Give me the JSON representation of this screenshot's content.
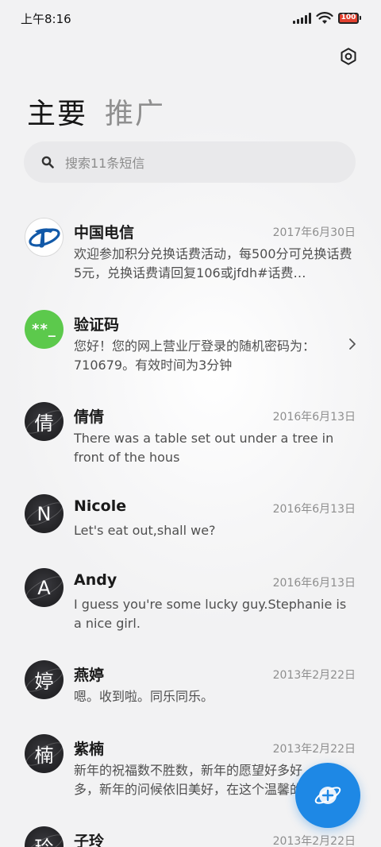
{
  "status_bar": {
    "time": "上午8:16",
    "battery": "100"
  },
  "header": {
    "tabs": [
      {
        "label": "主要"
      },
      {
        "label": "推广"
      }
    ]
  },
  "search": {
    "placeholder": "搜索11条短信"
  },
  "conversations": [
    {
      "name": "中国电信",
      "date": "2017年6月30日",
      "preview": "欢迎参加积分兑换话费活动，每500分可兑换话费5元，兑换话费请回复106或jfdh#话费…",
      "avatar": "telecom-logo"
    },
    {
      "name": "验证码",
      "date": "",
      "preview": "您好！您的网上营业厅登录的随机密码为：710679。有效时间为3分钟",
      "avatar_text": "**_"
    },
    {
      "name": "倩倩",
      "date": "2016年6月13日",
      "preview": "There was a table set out under a tree in front of the hous",
      "avatar_text": "倩"
    },
    {
      "name": "Nicole",
      "date": "2016年6月13日",
      "preview": "Let's eat out,shall we?",
      "avatar_text": "N"
    },
    {
      "name": "Andy",
      "date": "2016年6月13日",
      "preview": "I guess you're some lucky guy.Stephanie is a nice girl.",
      "avatar_text": "A"
    },
    {
      "name": "燕婷",
      "date": "2013年2月22日",
      "preview": "嗯。收到啦。同乐同乐。",
      "avatar_text": "婷"
    },
    {
      "name": "紫楠",
      "date": "2013年2月22日",
      "preview": "新年的祝福数不胜数，新年的愿望好多好多，新年的问候依旧美好，在这个温馨的",
      "avatar_text": "楠"
    },
    {
      "name": "子玲",
      "date": "2013年2月22日",
      "preview": "",
      "avatar_text": "玲"
    }
  ],
  "icons": {
    "settings": "settings-icon",
    "search": "search-icon",
    "compose": "compose-message-icon",
    "chevron": "chevron-right-icon"
  },
  "colors": {
    "accent": "#1e88e5",
    "verification_avatar": "#5cc94c",
    "background": "#f3f3f4"
  }
}
